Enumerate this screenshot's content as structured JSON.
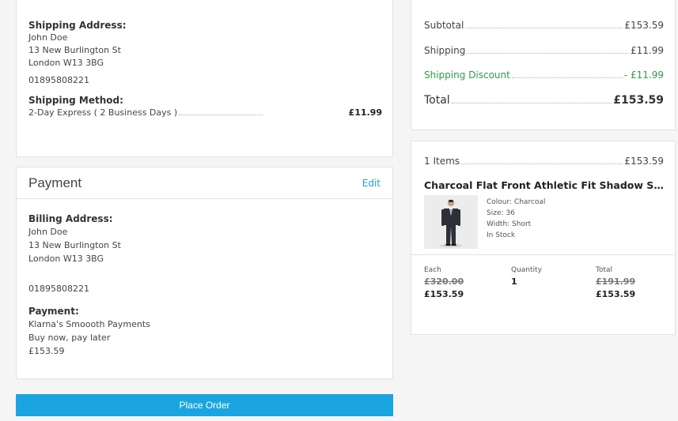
{
  "shipping": {
    "address_title": "Shipping Address:",
    "name": "John Doe",
    "street": "13 New Burlington St",
    "city": "London W13 3BG",
    "phone": "01895808221",
    "method_title": "Shipping Method:",
    "method": "2-Day Express ( 2 Business Days )",
    "method_price": "£11.99"
  },
  "payment": {
    "heading": "Payment",
    "edit_label": "Edit",
    "billing_title": "Billing Address:",
    "name": "John Doe",
    "street": "13 New Burlington St",
    "city": "London W13 3BG",
    "phone": "01895808221",
    "payment_title": "Payment:",
    "provider": "Klarna's Smoooth Payments",
    "tagline": "Buy now, pay later",
    "amount": "£153.59"
  },
  "place_order_label": "Place Order",
  "totals": {
    "subtotal_label": "Subtotal",
    "subtotal_value": "£153.59",
    "shipping_label": "Shipping",
    "shipping_value": "£11.99",
    "discount_label": "Shipping Discount",
    "discount_value": "- £11.99",
    "total_label": "Total",
    "total_value": "£153.59",
    "discount_color": "#2e9a4a"
  },
  "items": {
    "count_label": "1 Items",
    "count_value": "£153.59",
    "product": {
      "name": "Charcoal Flat Front Athletic Fit Shadow Striped Wo...",
      "colour": "Colour: Charcoal",
      "size": "Size: 36",
      "width": "Width: Short",
      "stock": "In Stock"
    },
    "each_header": "Each",
    "each_was": "£320.00",
    "each_now": "£153.59",
    "qty_header": "Quantity",
    "qty_value": "1",
    "total_header": "Total",
    "total_was": "£191.99",
    "total_now": "£153.59"
  },
  "colors": {
    "accent": "#1aa5e0",
    "link": "#1e9fd8"
  }
}
